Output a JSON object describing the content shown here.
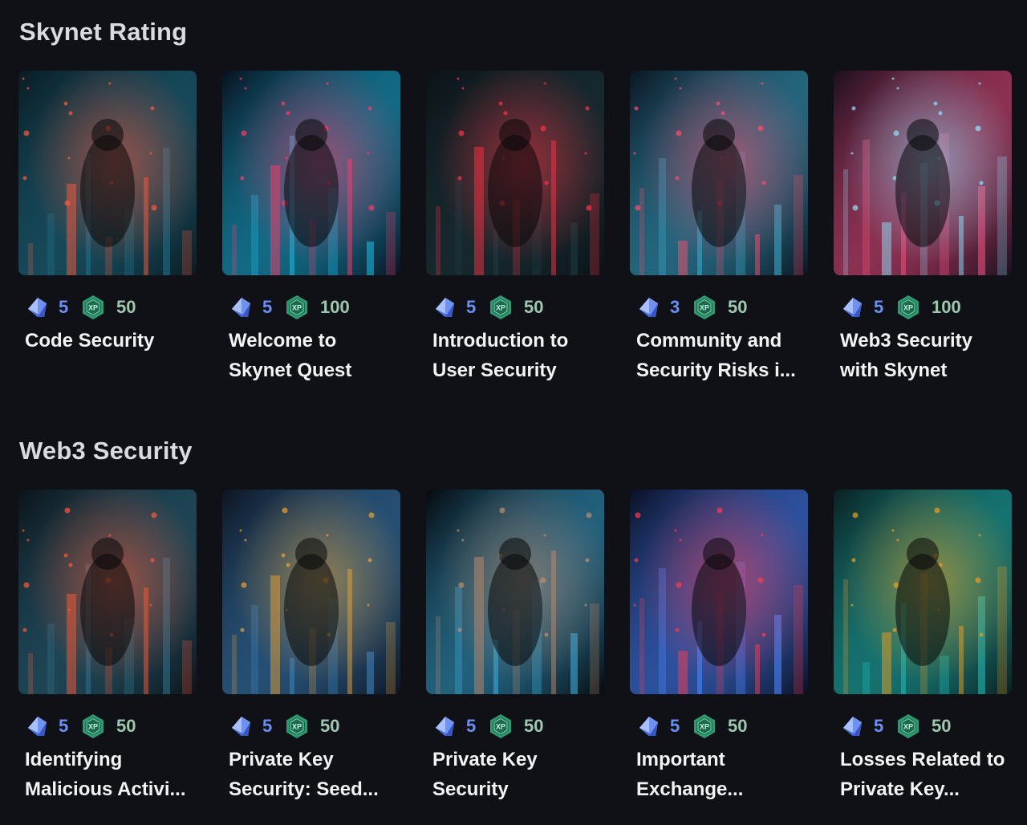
{
  "sections": [
    {
      "title": "Skynet Rating",
      "cards": [
        {
          "gems": "5",
          "xp": "50",
          "title": "Code Security",
          "palette": [
            "#0a1a22",
            "#1f6e86",
            "#ff5a3c"
          ]
        },
        {
          "gems": "5",
          "xp": "100",
          "title": "Welcome to\nSkynet Quest",
          "palette": [
            "#08101e",
            "#1ab3d8",
            "#ff3b6b"
          ]
        },
        {
          "gems": "5",
          "xp": "50",
          "title": "Introduction to\nUser Security",
          "palette": [
            "#0b1216",
            "#1e3a40",
            "#ff3344"
          ]
        },
        {
          "gems": "3",
          "xp": "50",
          "title": "Community and\nSecurity Risks i...",
          "palette": [
            "#0a1420",
            "#3aa7c8",
            "#ff4d6d"
          ]
        },
        {
          "gems": "5",
          "xp": "100",
          "title": "Web3 Security\nwith Skynet",
          "palette": [
            "#1a0f1e",
            "#e94b7a",
            "#8ee6ff"
          ]
        }
      ]
    },
    {
      "title": "Web3 Security",
      "cards": [
        {
          "gems": "5",
          "xp": "50",
          "title": "Identifying\nMalicious Activi...",
          "palette": [
            "#0c1218",
            "#2c6e86",
            "#ff5a36"
          ]
        },
        {
          "gems": "5",
          "xp": "50",
          "title": "Private Key\nSecurity: Seed...",
          "palette": [
            "#0d1420",
            "#3a7fb8",
            "#e8a33a"
          ]
        },
        {
          "gems": "5",
          "xp": "50",
          "title": "Private Key\nSecurity",
          "palette": [
            "#05080c",
            "#3aa8d8",
            "#c48b6a"
          ]
        },
        {
          "gems": "5",
          "xp": "50",
          "title": "Important\nExchange...",
          "palette": [
            "#0a0f24",
            "#4a86ff",
            "#ff3b4d"
          ]
        },
        {
          "gems": "5",
          "xp": "50",
          "title": "Losses Related to\nPrivate Key...",
          "palette": [
            "#0a1e20",
            "#1fb7b0",
            "#f0a020"
          ]
        }
      ]
    }
  ],
  "icons": {
    "gem": "gem-icon",
    "xp": "xp-badge-icon"
  },
  "colors": {
    "background": "#0f1116",
    "gem_count": "#6b8ff5",
    "xp_count": "#9ec9b0"
  }
}
